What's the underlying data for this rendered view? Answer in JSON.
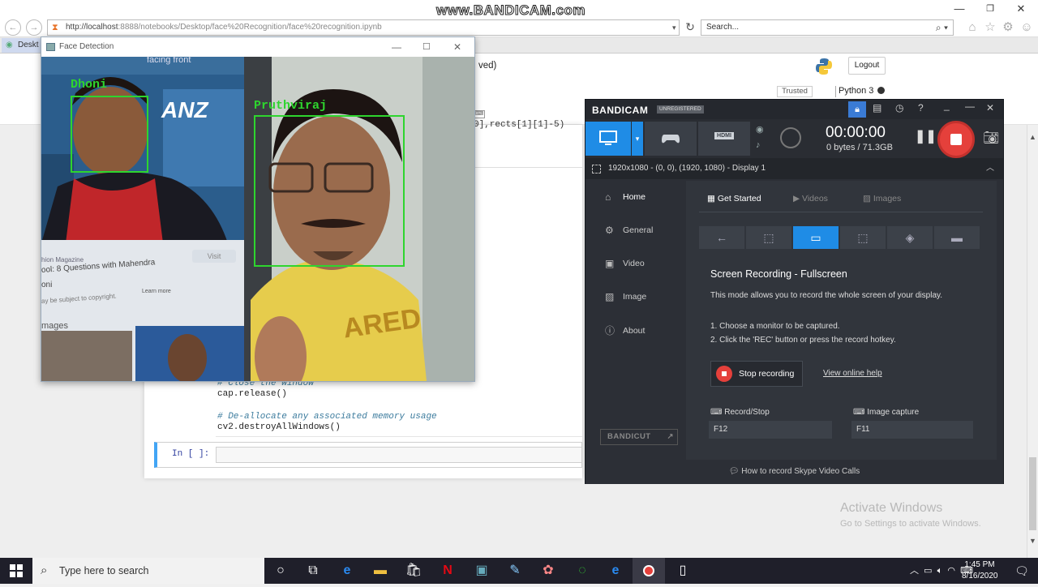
{
  "watermark": "www.BANDICAM.com",
  "browser": {
    "url": "http://localhost:8888/notebooks/Desktop/face%20Recognition/face%20recognition.ipynb",
    "url_host_part": "http://localhost",
    "url_rest_part": ":8888/notebooks/Desktop/face%20Recognition/face%20recognition.ipynb",
    "search_placeholder": "Search...",
    "tab_label": "Deskt"
  },
  "jupyter": {
    "saved_fragment": "ved)",
    "logout_label": "Logout",
    "trusted_label": "Trusted",
    "kernel_label": "Python 3",
    "code_fragment": "0],rects[1][1]-5)",
    "comment_close": "# Close the window",
    "line_release": "cap.release()",
    "comment_dealloc": "# De-allocate any associated memory usage",
    "line_destroy": "cv2.destroyAllWindows()",
    "prompt": "In [ ]:"
  },
  "face_window": {
    "title": "Face Detection",
    "labels": [
      "Dhoni",
      "Pruthviraj"
    ],
    "bg_texts": {
      "top": "facing front",
      "brand": "ANZ",
      "magazine": "hion Magazine",
      "headline": "ool: 8 Questions with Mahendra",
      "name_frag": "oni",
      "copyright": "ay be subject to copyright.",
      "learn_more": "Learn more",
      "visit": "Visit",
      "images": "mages",
      "shirt": "ARED"
    }
  },
  "bandicam": {
    "brand": "BANDICAM",
    "unregistered": "UNREGISTERED",
    "timer": "00:00:00",
    "size": "0 bytes / 71.3GB",
    "source": "1920x1080 - (0, 0), (1920, 1080) - Display 1",
    "hdmi": "HDMI",
    "sidebar": [
      "Home",
      "General",
      "Video",
      "Image",
      "About"
    ],
    "tabs": [
      "Get Started",
      "Videos",
      "Images"
    ],
    "heading": "Screen Recording - Fullscreen",
    "desc": "This mode allows you to record the whole screen of your display.",
    "step1": "1. Choose a monitor to be captured.",
    "step2": "2. Click the 'REC' button or press the record hotkey.",
    "stop_label": "Stop recording",
    "help_link": "View online help",
    "record_stop_label": "Record/Stop",
    "record_stop_key": "F12",
    "image_capture_label": "Image capture",
    "image_capture_key": "F11",
    "bandicut": "BANDICUT",
    "footer": "How to record Skype Video Calls"
  },
  "activate": {
    "title": "Activate Windows",
    "sub": "Go to Settings to activate Windows."
  },
  "taskbar": {
    "search_placeholder": "Type here to search",
    "time": "1:45 PM",
    "date": "8/16/2020"
  }
}
